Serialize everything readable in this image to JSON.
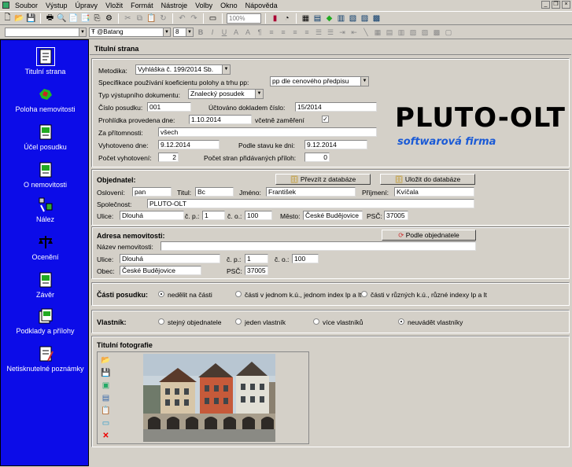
{
  "menu": [
    "Soubor",
    "Výstup",
    "Úpravy",
    "Vložit",
    "Formát",
    "Nástroje",
    "Volby",
    "Okno",
    "Nápověda"
  ],
  "toolbar": {
    "zoom": "100%"
  },
  "toolbar2": {
    "style": "",
    "font": "Ŧ @Batang",
    "size": "8",
    "fmt": [
      "B",
      "I",
      "U",
      "A",
      "A"
    ]
  },
  "sidebar": {
    "items": [
      {
        "label": "Titulní strana",
        "icon": "document-icon"
      },
      {
        "label": "Poloha nemovitosti",
        "icon": "map-icon"
      },
      {
        "label": "Účel posudku",
        "icon": "document-icon"
      },
      {
        "label": "O nemovitosti",
        "icon": "document-icon"
      },
      {
        "label": "Nález",
        "icon": "tools-icon"
      },
      {
        "label": "Ocenění",
        "icon": "scales-icon"
      },
      {
        "label": "Závěr",
        "icon": "document-icon"
      },
      {
        "label": "Podklady a přílohy",
        "icon": "folder-icon"
      },
      {
        "label": "Netisknutelné poznámky",
        "icon": "notes-icon"
      }
    ]
  },
  "page": {
    "title": "Titulní strana"
  },
  "general": {
    "metodika_label": "Metodika:",
    "metodika_value": "Vyhláška č. 199/2014 Sb.",
    "koef_label": "Specifikace používání koeficientu polohy a trhu pp:",
    "koef_value": "pp dle cenového předpisu",
    "typ_label": "Typ výstupního dokumentu:",
    "typ_value": "Znalecký posudek",
    "cislo_label": "Číslo posudku:",
    "cislo_value": "001",
    "uctovano_label": "Účtováno dokladem číslo:",
    "uctovano_value": "15/2014",
    "prohlidka_label": "Prohlídka provedena dne:",
    "prohlidka_value": "1.10.2014",
    "zamereni_label": "včetně zaměření",
    "zamereni_checked": "✓",
    "pritomnosti_label": "Za přítomnosti:",
    "pritomnosti_value": "všech",
    "vyhotoveno_label": "Vyhotoveno dne:",
    "vyhotoveno_value": "9.12.2014",
    "stav_label": "Podle stavu ke dni:",
    "stav_value": "9.12.2014",
    "pocet_vyh_label": "Počet vyhotovení:",
    "pocet_vyh_value": "2",
    "pocet_stran_label": "Počet stran přidávaných příloh:",
    "pocet_stran_value": "0"
  },
  "logo": {
    "main": "PLUTO-OLT",
    "sub": "softwarová firma"
  },
  "objednatel": {
    "title": "Objednatel:",
    "prevzit": "Převzít z databáze",
    "ulozit": "Uložit do databáze",
    "osloveni_label": "Oslovení:",
    "osloveni": "pan",
    "titul_label": "Titul:",
    "titul": "Bc",
    "jmeno_label": "Jméno:",
    "jmeno": "František",
    "prijmeni_label": "Příjmení:",
    "prijmeni": "Kvíčala",
    "spolecnost_label": "Společnost:",
    "spolecnost": "PLUTO-OLT",
    "ulice_label": "Ulice:",
    "ulice": "Dlouhá",
    "cp_label": "č. p.:",
    "cp": "1",
    "co_label": "č. o.:",
    "co": "100",
    "mesto_label": "Město:",
    "mesto": "České Budějovice",
    "psc_label": "PSČ:",
    "psc": "37005"
  },
  "adresa": {
    "title": "Adresa nemovitosti:",
    "podle": "Podle objednatele",
    "nazev_label": "Název nemovitosti:",
    "nazev": "",
    "ulice_label": "Ulice:",
    "ulice": "Dlouhá",
    "cp_label": "č. p.:",
    "cp": "1",
    "co_label": "č. o.:",
    "co": "100",
    "obec_label": "Obec:",
    "obec": "České Budějovice",
    "psc_label": "PSČ:",
    "psc": "37005"
  },
  "casti": {
    "title": "Části posudku:",
    "options": [
      "nedělit na části",
      "části v jednom k.ú., jednom index lp a lt",
      "části v různých k.ú., různé indexy lp a lt"
    ],
    "selected": 0
  },
  "vlastnik": {
    "title": "Vlastník:",
    "options": [
      "stejný objednatele",
      "jeden vlastník",
      "více vlastníků",
      "neuvádět vlastníky"
    ],
    "selected": 3
  },
  "foto": {
    "title": "Titulní fotografie"
  },
  "colors": {
    "sidebar": "#0c0ce8",
    "logo_blue": "#1a5ad6"
  }
}
